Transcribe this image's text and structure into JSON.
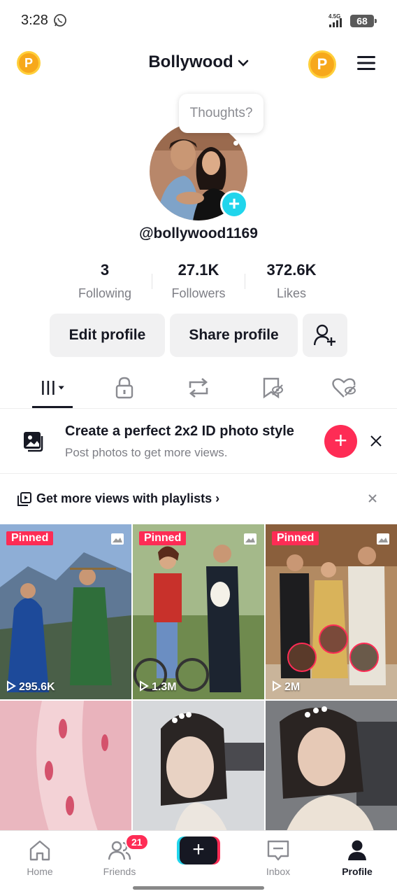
{
  "status_bar": {
    "time": "3:28",
    "network": "4.5G",
    "battery": "68"
  },
  "header": {
    "account_name": "Bollywood",
    "coin_letter": "P"
  },
  "profile": {
    "bubble_text": "Thoughts?",
    "username": "@bollywood1169",
    "stats": [
      {
        "value": "3",
        "label": "Following"
      },
      {
        "value": "27.1K",
        "label": "Followers"
      },
      {
        "value": "372.6K",
        "label": "Likes"
      }
    ],
    "edit_label": "Edit profile",
    "share_label": "Share profile"
  },
  "tabs": [
    "videos-tab",
    "private-tab",
    "reposts-tab",
    "favorites-tab",
    "liked-tab"
  ],
  "promo": {
    "title": "Create a perfect 2x2 ID photo style",
    "subtitle": "Post photos to get more views."
  },
  "playlist": {
    "text": "Get more views with playlists"
  },
  "grid": {
    "pinned_label": "Pinned",
    "items": [
      {
        "views": "295.6K",
        "pinned": true,
        "colors": [
          "#6b8ab5",
          "#2f6e3a",
          "#1d4a9a"
        ]
      },
      {
        "views": "1.3M",
        "pinned": true,
        "colors": [
          "#8fa86a",
          "#c8312b",
          "#1c2430"
        ]
      },
      {
        "views": "2M",
        "pinned": true,
        "colors": [
          "#a67b56",
          "#d9b35a",
          "#e8e3d8"
        ]
      },
      {
        "views": "",
        "pinned": false,
        "colors": [
          "#f1c9cf",
          "#e7a9b4",
          "#d4859a"
        ]
      },
      {
        "views": "",
        "pinned": false,
        "colors": [
          "#c7c9cc",
          "#2a2524",
          "#e8e5e2"
        ]
      },
      {
        "views": "",
        "pinned": false,
        "colors": [
          "#6d6f73",
          "#2a2422",
          "#e6ddd3"
        ]
      }
    ]
  },
  "nav": {
    "home": "Home",
    "friends": "Friends",
    "friends_badge": "21",
    "inbox": "Inbox",
    "profile": "Profile"
  },
  "colors": {
    "accent": "#fe2c55",
    "cyan": "#20d5ec",
    "coin": "#f7a81b"
  }
}
